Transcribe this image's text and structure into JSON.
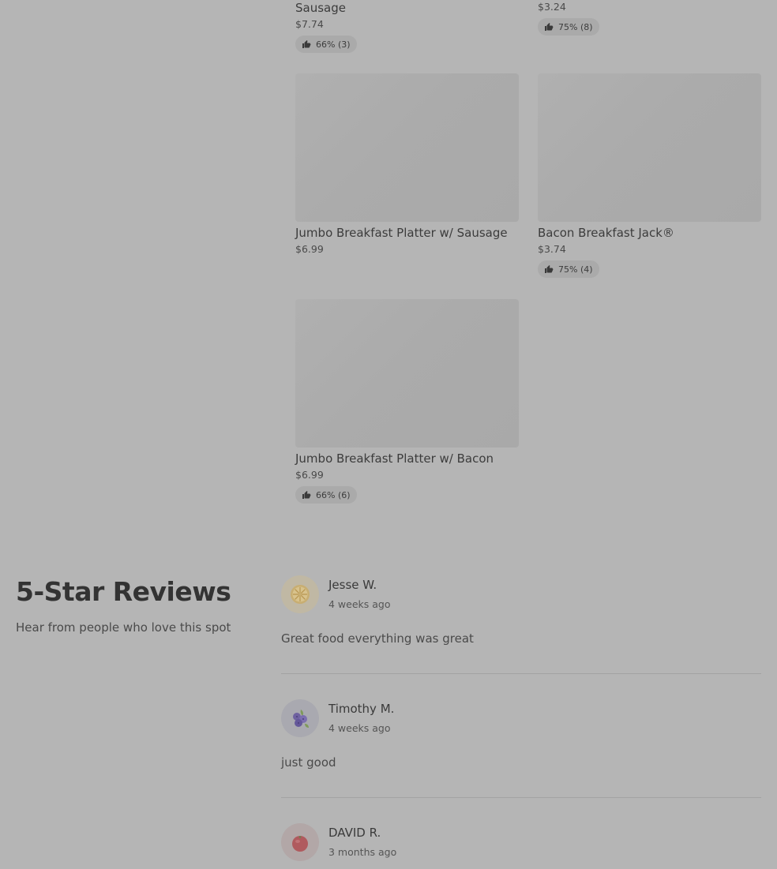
{
  "menu_items": [
    {
      "name": "Sausage",
      "price": "$7.74",
      "rating": "66% (3)"
    },
    {
      "name": "",
      "price": "$3.24",
      "rating": "75% (8)"
    },
    {
      "name": "Jumbo Breakfast Platter w/ Sausage",
      "price": "$6.99"
    },
    {
      "name": "Bacon Breakfast Jack®",
      "price": "$3.74",
      "rating": "75% (4)"
    },
    {
      "name": "Jumbo Breakfast Platter w/ Bacon",
      "price": "$6.99",
      "rating": "66% (6)"
    }
  ],
  "reviews_section": {
    "title": "5-Star Reviews",
    "subtitle": "Hear from people who love this spot"
  },
  "reviews": [
    {
      "author": "Jesse W.",
      "date": "4 weeks ago",
      "text": "Great food everything was great",
      "avatar_icon": "lemon-slice-icon"
    },
    {
      "author": "Timothy M.",
      "date": "4 weeks ago",
      "text": "just good",
      "avatar_icon": "blueberries-icon"
    },
    {
      "author": "DAVID R.",
      "date": "3 months ago",
      "text": "",
      "avatar_icon": "tomato-icon"
    }
  ],
  "icons": {
    "rating": "thumbs-up-icon"
  },
  "colors": {
    "overlay_background": "#b5b5b5",
    "text_dark": "#333333"
  }
}
